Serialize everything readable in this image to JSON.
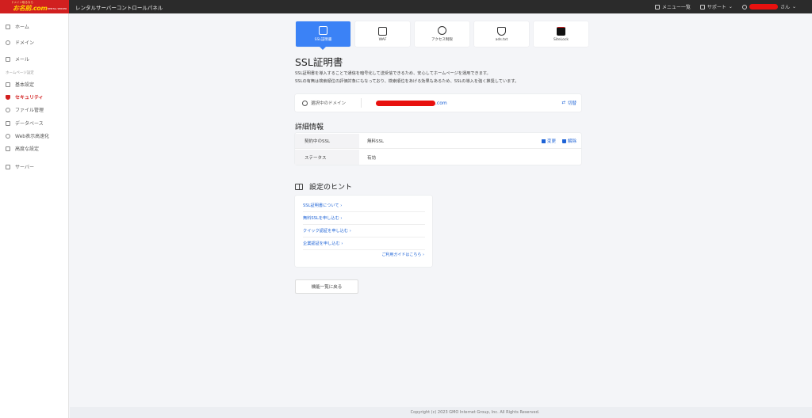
{
  "header": {
    "logo_tagline": "ドメイン取るなら",
    "logo_text": "お名前.com",
    "logo_sub": "RENTAL SERVER",
    "title": "レンタルサーバーコントロールパネル",
    "menu_label": "メニュー一覧",
    "support_label": "サポート",
    "user_suffix": "さん",
    "icons": [
      "grid-icon",
      "book-icon",
      "user-icon"
    ]
  },
  "sidebar": {
    "items": [
      {
        "label": "ホーム",
        "icon": "home-icon"
      },
      {
        "label": "ドメイン",
        "icon": "globe-icon"
      },
      {
        "label": "メール",
        "icon": "mail-icon"
      }
    ],
    "section_label": "ホームページ設定",
    "sub_items": [
      {
        "label": "基本設定",
        "icon": "monitor-icon"
      },
      {
        "label": "セキュリティ",
        "icon": "shield-icon"
      },
      {
        "label": "ファイル管理",
        "icon": "people-icon"
      },
      {
        "label": "データベース",
        "icon": "database-icon"
      },
      {
        "label": "Web表示高速化",
        "icon": "speed-icon"
      },
      {
        "label": "高度な設定",
        "icon": "settings-icon"
      },
      {
        "label": "サーバー",
        "icon": "server-icon"
      }
    ]
  },
  "tabs": [
    {
      "label": "SSL証明書",
      "icon": "certificate-icon",
      "active": true
    },
    {
      "label": "WAF",
      "icon": "firewall-icon",
      "active": false
    },
    {
      "label": "アクセス制限",
      "icon": "block-icon",
      "active": false
    },
    {
      "label": "ads.txt",
      "icon": "ads-shield-icon",
      "active": false
    },
    {
      "label": "SiteLock",
      "icon": "sitelock-icon",
      "active": false
    }
  ],
  "page": {
    "title": "SSL証明書",
    "desc_line1": "SSL証明書を導入することで通信を暗号化して送受信できるため、安心してホームページを運用できます。",
    "desc_line2": "SSLの有無は検索順位の評価対象にもなっており、検索順位をあげる効果もあるため、SSLの導入を強く推奨しています。"
  },
  "domain": {
    "label": "選択中のドメイン",
    "value_suffix": ".com",
    "switch_label": "切替"
  },
  "details": {
    "title": "詳細情報",
    "rows": [
      {
        "key": "契約中のSSL",
        "value": "無料SSL"
      },
      {
        "key": "ステータス",
        "value": "有効"
      }
    ],
    "change_label": "変更",
    "delete_label": "解除"
  },
  "hints": {
    "title": "設定のヒント",
    "links": [
      "SSL証明書について ›",
      "無料SSLを申し込む ›",
      "クイック認証を申し込む ›",
      "企業認証を申し込む ›"
    ],
    "guide_link": "ご利用ガイドはこちら ›"
  },
  "back_button": "機能一覧に戻る",
  "footer": "Copyright (c) 2023 GMO Internet Group, Inc. All Rights Reserved.",
  "colors": {
    "brand_red": "#d11f1f",
    "accent_blue": "#3b82f6",
    "link_blue": "#1e63d6",
    "topbar": "#2b2b2b"
  }
}
